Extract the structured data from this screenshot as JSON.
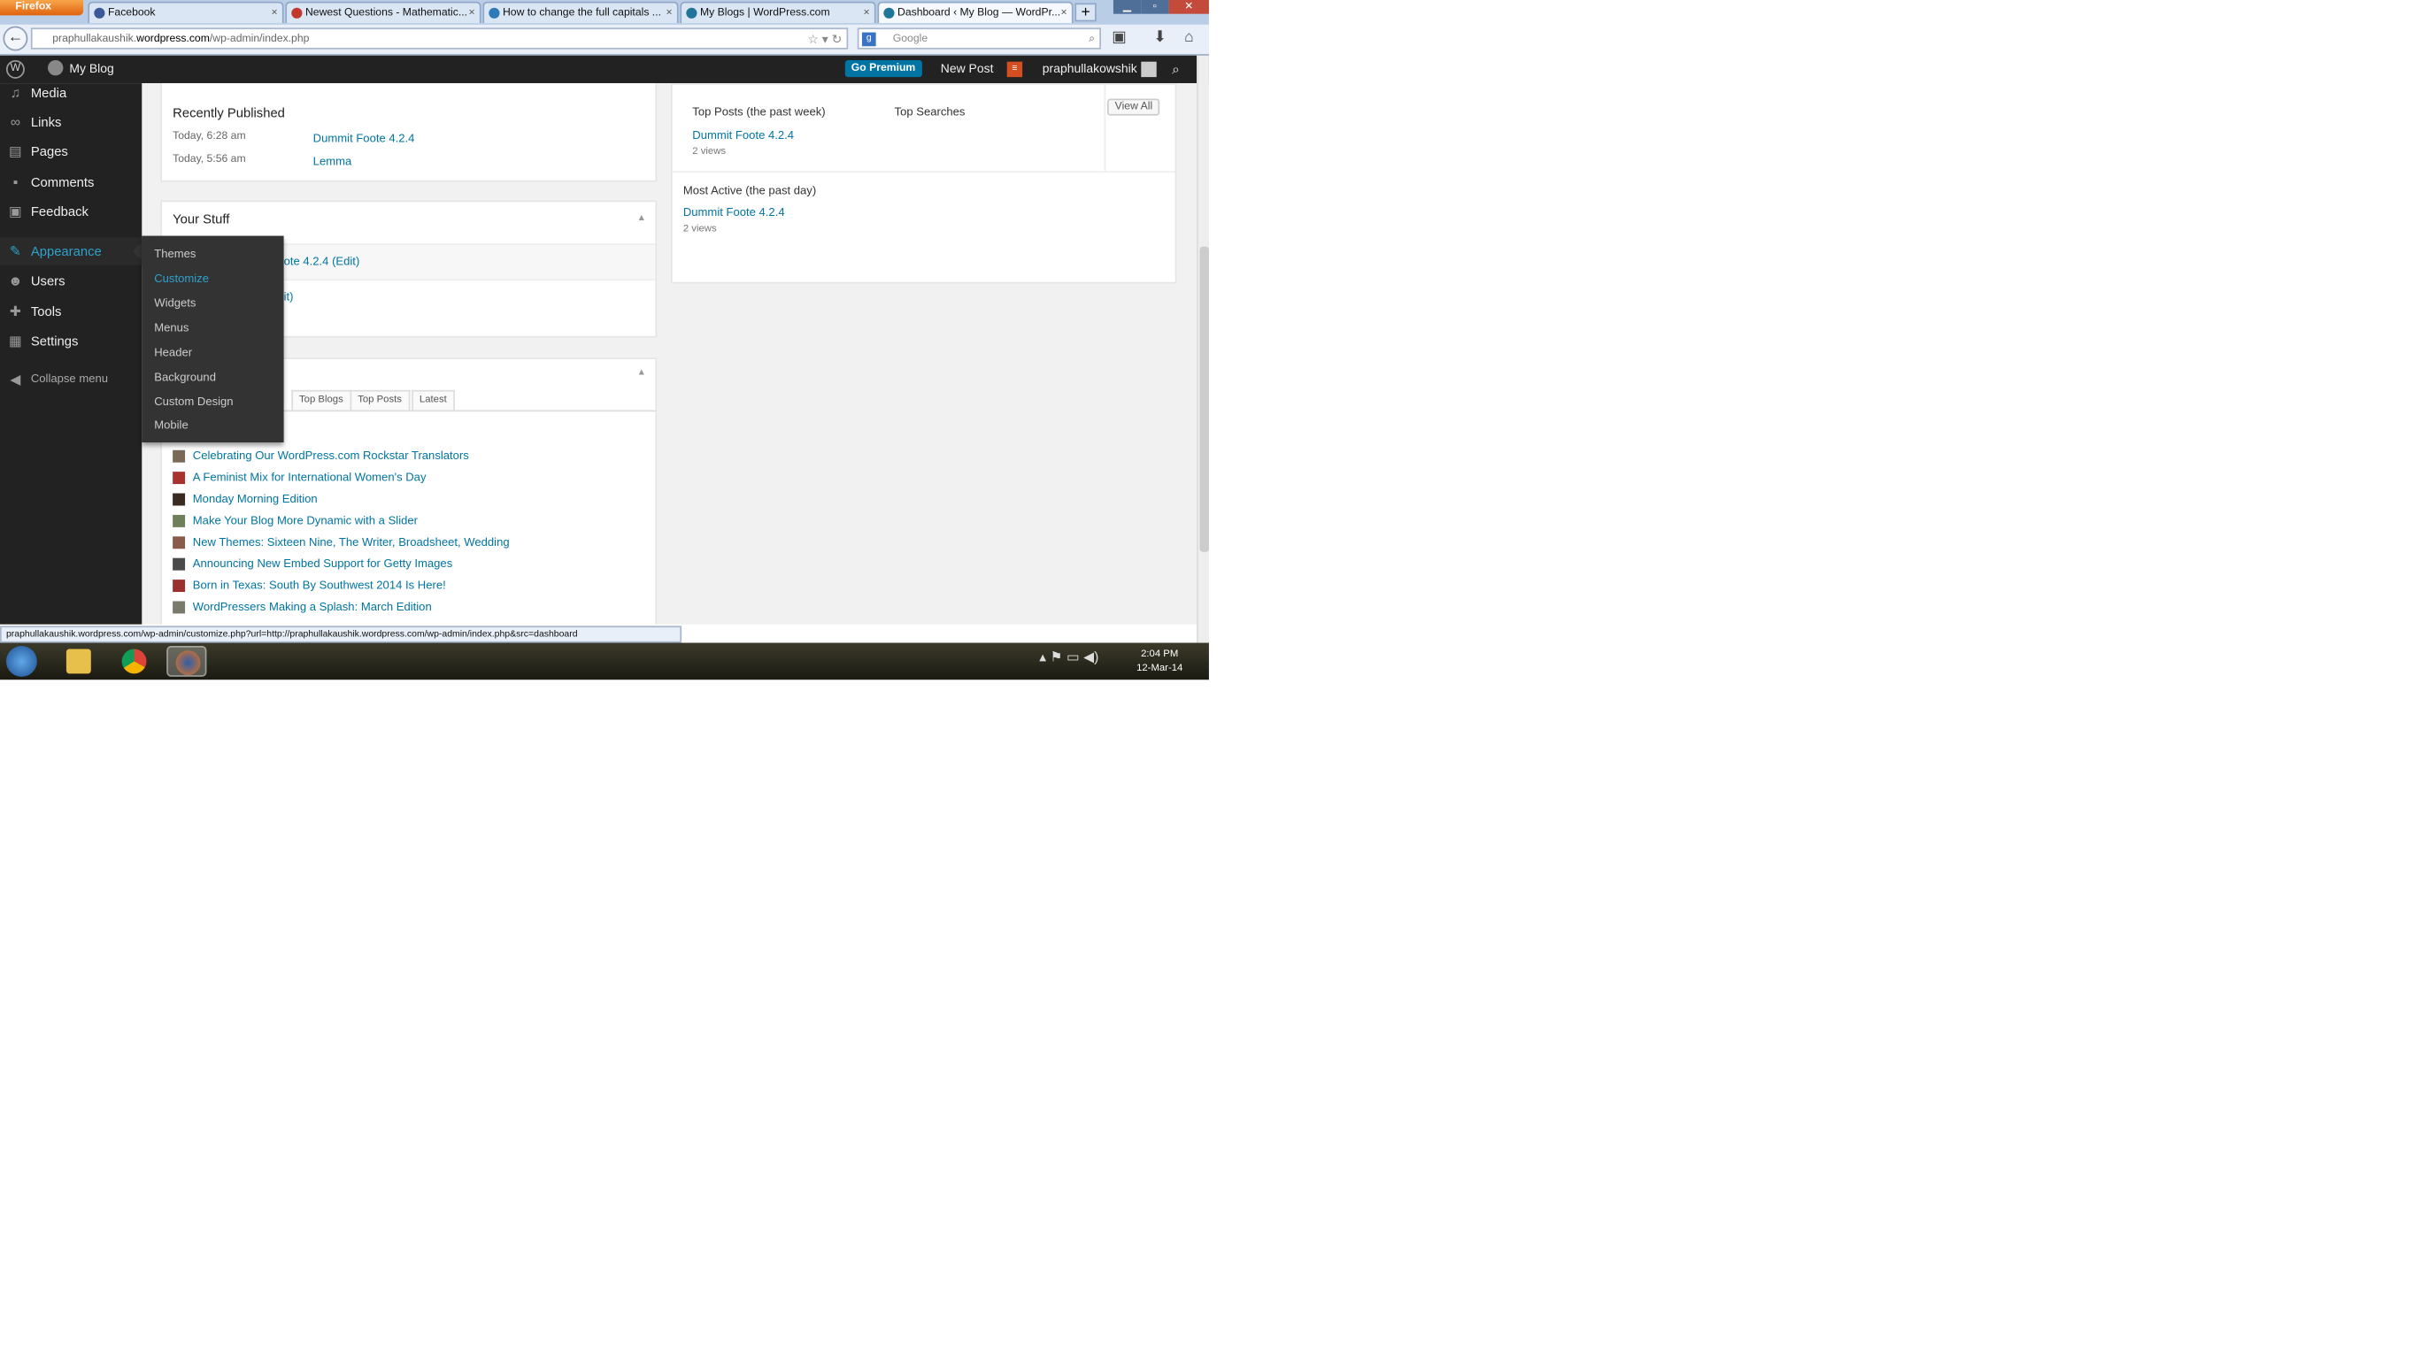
{
  "browser": {
    "menu_button": "Firefox",
    "tabs": [
      {
        "title": "Facebook",
        "icon_color": "#3b5998",
        "active": false
      },
      {
        "title": "Newest Questions - Mathematic...",
        "icon_color": "#c0392b",
        "active": false
      },
      {
        "title": "How to change the full capitals ...",
        "icon_color": "#2e7ab8",
        "active": false
      },
      {
        "title": "My Blogs | WordPress.com",
        "icon_color": "#21759b",
        "active": false
      },
      {
        "title": "Dashboard ‹ My Blog — WordPr...",
        "icon_color": "#21759b",
        "active": true
      }
    ],
    "url_prefix": "praphullakaushik.",
    "url_domain": "wordpress.com",
    "url_path": "/wp-admin/index.php",
    "search_placeholder": "Google",
    "status_url": "praphullakaushik.wordpress.com/wp-admin/customize.php?url=http://praphullakaushik.wordpress.com/wp-admin/index.php&src=dashboard"
  },
  "adminbar": {
    "site": "My Blog",
    "premium": "Go Premium",
    "new_post": "New Post",
    "username": "praphullakowshik"
  },
  "sidebar": {
    "items": [
      {
        "label": "Media",
        "icon": "media-icon"
      },
      {
        "label": "Links",
        "icon": "links-icon"
      },
      {
        "label": "Pages",
        "icon": "pages-icon"
      },
      {
        "label": "Comments",
        "icon": "comments-icon"
      },
      {
        "label": "Feedback",
        "icon": "feedback-icon"
      },
      {
        "label": "Appearance",
        "icon": "appearance-icon"
      },
      {
        "label": "Users",
        "icon": "users-icon"
      },
      {
        "label": "Tools",
        "icon": "tools-icon"
      },
      {
        "label": "Settings",
        "icon": "settings-icon"
      }
    ],
    "collapse": "Collapse menu"
  },
  "flyout": {
    "items": [
      "Themes",
      "Customize",
      "Widgets",
      "Menus",
      "Header",
      "Background",
      "Custom Design",
      "Mobile"
    ]
  },
  "activity": {
    "heading": "Recently Published",
    "rows": [
      {
        "time": "Today, 6:28 am",
        "title": "Dummit Foote 4.2.4"
      },
      {
        "time": "Today, 5:56 am",
        "title": "Lemma"
      }
    ]
  },
  "your_stuff": {
    "title": "Your Stuff",
    "line1": "ote 4.2.4 (Edit)",
    "line2": "it)"
  },
  "reader": {
    "tabs": [
      "Top Blogs",
      "Top Posts",
      "Latest"
    ],
    "items": [
      "Celebrating Our WordPress.com Rockstar Translators",
      "A Feminist Mix for International Women's Day",
      "Monday Morning Edition",
      "Make Your Blog More Dynamic with a Slider",
      "New Themes: Sixteen Nine, The Writer, Broadsheet, Wedding",
      "Announcing New Embed Support for Getty Images",
      "Born in Texas: South By Southwest 2014 Is Here!",
      "WordPressers Making a Splash: March Edition"
    ]
  },
  "stats": {
    "top_posts_label": "Top Posts (the past week)",
    "top_searches_label": "Top Searches",
    "view_all": "View All",
    "top_post": "Dummit Foote 4.2.4",
    "top_post_views": "2 views",
    "most_active_label": "Most Active (the past day)",
    "most_active_post": "Dummit Foote 4.2.4",
    "most_active_views": "2 views"
  },
  "clock": {
    "time": "2:04 PM",
    "date": "12-Mar-14"
  }
}
